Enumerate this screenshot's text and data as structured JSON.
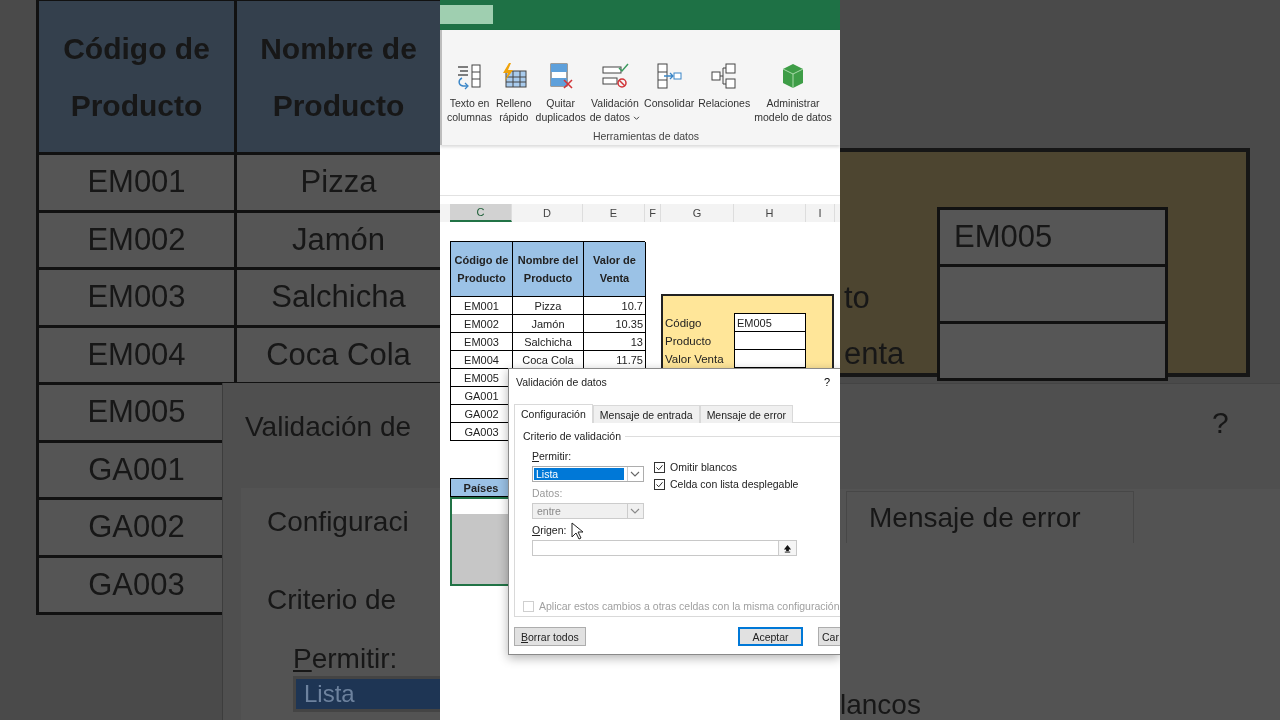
{
  "backdrop_left": {
    "headers": [
      [
        "Código de",
        "Producto"
      ],
      [
        "Nombre de",
        "Producto"
      ]
    ],
    "rows": [
      [
        "EM001",
        "Pizza"
      ],
      [
        "EM002",
        "Jamón"
      ],
      [
        "EM003",
        "Salchicha"
      ],
      [
        "EM004",
        "Coca Cola"
      ],
      [
        "EM005"
      ],
      [
        "GA001"
      ],
      [
        "GA002"
      ],
      [
        "GA003"
      ]
    ],
    "dialog": {
      "title": "Validación de",
      "tab": "Configuraci",
      "section": "Criterio de",
      "allow_label": "Permitir:",
      "allow_value": "Lista"
    }
  },
  "ribbon": {
    "buttons": [
      {
        "kind": "text-to-columns",
        "lines": [
          "Texto en",
          "columnas"
        ],
        "has_menu": false
      },
      {
        "kind": "flash-fill",
        "lines": [
          "Relleno",
          "rápido"
        ],
        "has_menu": false
      },
      {
        "kind": "remove-duplicates",
        "lines": [
          "Quitar",
          "duplicados"
        ],
        "has_menu": false
      },
      {
        "kind": "data-validation",
        "lines": [
          "Validación",
          "de datos"
        ],
        "has_menu": true
      },
      {
        "kind": "consolidate",
        "lines": [
          "Consolidar"
        ],
        "has_menu": false
      },
      {
        "kind": "relationships",
        "lines": [
          "Relaciones"
        ],
        "has_menu": false
      },
      {
        "kind": "data-model",
        "lines": [
          "Administrar",
          "modelo de datos"
        ],
        "has_menu": false
      }
    ],
    "group_label": "Herramientas de datos"
  },
  "sheet": {
    "columns": [
      {
        "label": "C",
        "selected": true
      },
      {
        "label": "D",
        "selected": false
      },
      {
        "label": "E",
        "selected": false
      },
      {
        "label": "F",
        "selected": false
      },
      {
        "label": "G",
        "selected": false
      },
      {
        "label": "H",
        "selected": false
      },
      {
        "label": "I",
        "selected": false
      }
    ],
    "product_table": {
      "headers": [
        [
          "Código de",
          "Producto"
        ],
        [
          "Nombre del",
          "Producto"
        ],
        [
          "Valor de",
          "Venta"
        ]
      ],
      "rows": [
        {
          "code": "EM001",
          "name": "Pizza",
          "value": "10.7"
        },
        {
          "code": "EM002",
          "name": "Jamón",
          "value": "10.35"
        },
        {
          "code": "EM003",
          "name": "Salchicha",
          "value": "13"
        },
        {
          "code": "EM004",
          "name": "Coca Cola",
          "value": "11.75"
        },
        {
          "code": "EM005"
        },
        {
          "code": "GA001"
        },
        {
          "code": "GA002"
        },
        {
          "code": "GA003"
        }
      ]
    },
    "lookup": {
      "rows": [
        {
          "label": "Código",
          "value": "EM005"
        },
        {
          "label": "Producto"
        },
        {
          "label": "Valor Venta"
        }
      ]
    },
    "countries_table": {
      "header": "Países"
    }
  },
  "dialog": {
    "title": "Validación de datos",
    "help": "?",
    "tabs": [
      {
        "label": "Configuración",
        "selected": true
      },
      {
        "label": "Mensaje de entrada",
        "selected": false
      },
      {
        "label": "Mensaje de error",
        "selected": false
      }
    ],
    "section": "Criterio de validación",
    "allow": {
      "label": "Permitir:",
      "value": "Lista"
    },
    "data": {
      "label": "Datos:",
      "value": "entre",
      "disabled": true
    },
    "options": [
      {
        "label": "Omitir blancos",
        "checked": true
      },
      {
        "label": "Celda con lista desplegable",
        "checked": true
      }
    ],
    "source": {
      "label": "Origen:"
    },
    "apply_all": {
      "label": "Aplicar estos cambios a otras celdas con la misma configuración",
      "checked": false,
      "disabled": true
    },
    "buttons": [
      {
        "label": "Borrar todos",
        "default": false
      },
      {
        "label": "Aceptar",
        "default": true
      },
      {
        "label": "Car",
        "default": false
      }
    ]
  },
  "backdrop_right": {
    "lookup_labels": [
      "to",
      "enta"
    ],
    "lookup_value": "EM005",
    "help": "?",
    "tab": "Mensaje de error",
    "option": "lancos"
  }
}
